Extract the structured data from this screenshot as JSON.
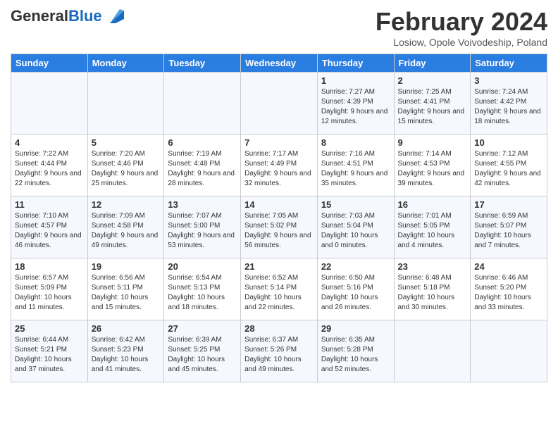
{
  "header": {
    "logo_general": "General",
    "logo_blue": "Blue",
    "title": "February 2024",
    "location": "Losiow, Opole Voivodeship, Poland"
  },
  "days_of_week": [
    "Sunday",
    "Monday",
    "Tuesday",
    "Wednesday",
    "Thursday",
    "Friday",
    "Saturday"
  ],
  "weeks": [
    [
      {
        "day": "",
        "info": ""
      },
      {
        "day": "",
        "info": ""
      },
      {
        "day": "",
        "info": ""
      },
      {
        "day": "",
        "info": ""
      },
      {
        "day": "1",
        "info": "Sunrise: 7:27 AM\nSunset: 4:39 PM\nDaylight: 9 hours\nand 12 minutes."
      },
      {
        "day": "2",
        "info": "Sunrise: 7:25 AM\nSunset: 4:41 PM\nDaylight: 9 hours\nand 15 minutes."
      },
      {
        "day": "3",
        "info": "Sunrise: 7:24 AM\nSunset: 4:42 PM\nDaylight: 9 hours\nand 18 minutes."
      }
    ],
    [
      {
        "day": "4",
        "info": "Sunrise: 7:22 AM\nSunset: 4:44 PM\nDaylight: 9 hours\nand 22 minutes."
      },
      {
        "day": "5",
        "info": "Sunrise: 7:20 AM\nSunset: 4:46 PM\nDaylight: 9 hours\nand 25 minutes."
      },
      {
        "day": "6",
        "info": "Sunrise: 7:19 AM\nSunset: 4:48 PM\nDaylight: 9 hours\nand 28 minutes."
      },
      {
        "day": "7",
        "info": "Sunrise: 7:17 AM\nSunset: 4:49 PM\nDaylight: 9 hours\nand 32 minutes."
      },
      {
        "day": "8",
        "info": "Sunrise: 7:16 AM\nSunset: 4:51 PM\nDaylight: 9 hours\nand 35 minutes."
      },
      {
        "day": "9",
        "info": "Sunrise: 7:14 AM\nSunset: 4:53 PM\nDaylight: 9 hours\nand 39 minutes."
      },
      {
        "day": "10",
        "info": "Sunrise: 7:12 AM\nSunset: 4:55 PM\nDaylight: 9 hours\nand 42 minutes."
      }
    ],
    [
      {
        "day": "11",
        "info": "Sunrise: 7:10 AM\nSunset: 4:57 PM\nDaylight: 9 hours\nand 46 minutes."
      },
      {
        "day": "12",
        "info": "Sunrise: 7:09 AM\nSunset: 4:58 PM\nDaylight: 9 hours\nand 49 minutes."
      },
      {
        "day": "13",
        "info": "Sunrise: 7:07 AM\nSunset: 5:00 PM\nDaylight: 9 hours\nand 53 minutes."
      },
      {
        "day": "14",
        "info": "Sunrise: 7:05 AM\nSunset: 5:02 PM\nDaylight: 9 hours\nand 56 minutes."
      },
      {
        "day": "15",
        "info": "Sunrise: 7:03 AM\nSunset: 5:04 PM\nDaylight: 10 hours\nand 0 minutes."
      },
      {
        "day": "16",
        "info": "Sunrise: 7:01 AM\nSunset: 5:05 PM\nDaylight: 10 hours\nand 4 minutes."
      },
      {
        "day": "17",
        "info": "Sunrise: 6:59 AM\nSunset: 5:07 PM\nDaylight: 10 hours\nand 7 minutes."
      }
    ],
    [
      {
        "day": "18",
        "info": "Sunrise: 6:57 AM\nSunset: 5:09 PM\nDaylight: 10 hours\nand 11 minutes."
      },
      {
        "day": "19",
        "info": "Sunrise: 6:56 AM\nSunset: 5:11 PM\nDaylight: 10 hours\nand 15 minutes."
      },
      {
        "day": "20",
        "info": "Sunrise: 6:54 AM\nSunset: 5:13 PM\nDaylight: 10 hours\nand 18 minutes."
      },
      {
        "day": "21",
        "info": "Sunrise: 6:52 AM\nSunset: 5:14 PM\nDaylight: 10 hours\nand 22 minutes."
      },
      {
        "day": "22",
        "info": "Sunrise: 6:50 AM\nSunset: 5:16 PM\nDaylight: 10 hours\nand 26 minutes."
      },
      {
        "day": "23",
        "info": "Sunrise: 6:48 AM\nSunset: 5:18 PM\nDaylight: 10 hours\nand 30 minutes."
      },
      {
        "day": "24",
        "info": "Sunrise: 6:46 AM\nSunset: 5:20 PM\nDaylight: 10 hours\nand 33 minutes."
      }
    ],
    [
      {
        "day": "25",
        "info": "Sunrise: 6:44 AM\nSunset: 5:21 PM\nDaylight: 10 hours\nand 37 minutes."
      },
      {
        "day": "26",
        "info": "Sunrise: 6:42 AM\nSunset: 5:23 PM\nDaylight: 10 hours\nand 41 minutes."
      },
      {
        "day": "27",
        "info": "Sunrise: 6:39 AM\nSunset: 5:25 PM\nDaylight: 10 hours\nand 45 minutes."
      },
      {
        "day": "28",
        "info": "Sunrise: 6:37 AM\nSunset: 5:26 PM\nDaylight: 10 hours\nand 49 minutes."
      },
      {
        "day": "29",
        "info": "Sunrise: 6:35 AM\nSunset: 5:28 PM\nDaylight: 10 hours\nand 52 minutes."
      },
      {
        "day": "",
        "info": ""
      },
      {
        "day": "",
        "info": ""
      }
    ]
  ]
}
